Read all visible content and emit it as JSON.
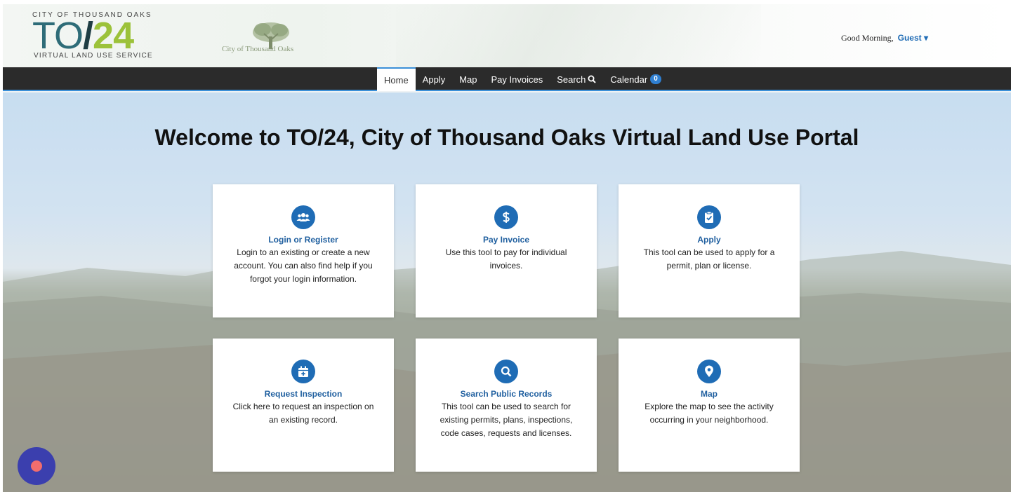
{
  "header": {
    "logo": {
      "top": "CITY OF THOUSAND OAKS",
      "to": "TO",
      "slash": "/",
      "num": "24",
      "bottom": "VIRTUAL LAND USE SERVICE"
    },
    "seal_text": "City of Thousand Oaks",
    "greeting": "Good Morning,",
    "user": "Guest"
  },
  "nav": {
    "items": [
      {
        "label": "Home"
      },
      {
        "label": "Apply"
      },
      {
        "label": "Map"
      },
      {
        "label": "Pay Invoices"
      },
      {
        "label": "Search"
      },
      {
        "label": "Calendar",
        "badge": "0"
      }
    ]
  },
  "main": {
    "welcome": "Welcome to TO/24, City of Thousand Oaks Virtual Land Use Portal",
    "cards": [
      {
        "icon": "users-icon",
        "title": "Login or Register",
        "desc": "Login to an existing or create a new account. You can also find help if you forgot your login information."
      },
      {
        "icon": "dollar-icon",
        "title": "Pay Invoice",
        "desc": "Use this tool to pay for individual invoices."
      },
      {
        "icon": "clipboard-check-icon",
        "title": "Apply",
        "desc": "This tool can be used to apply for a permit, plan or license."
      },
      {
        "icon": "calendar-plus-icon",
        "title": "Request Inspection",
        "desc": "Click here to request an inspection on an existing record."
      },
      {
        "icon": "search-icon",
        "title": "Search Public Records",
        "desc": "This tool can be used to search for existing permits, plans, inspections, code cases, requests and licenses."
      },
      {
        "icon": "map-pin-icon",
        "title": "Map",
        "desc": "Explore the map to see the activity occurring in your neighborhood."
      }
    ]
  },
  "colors": {
    "accent": "#1f6cb5",
    "nav_bg": "#2b2b2b",
    "brand_green": "#9cc23a",
    "brand_teal": "#2e6c78"
  }
}
